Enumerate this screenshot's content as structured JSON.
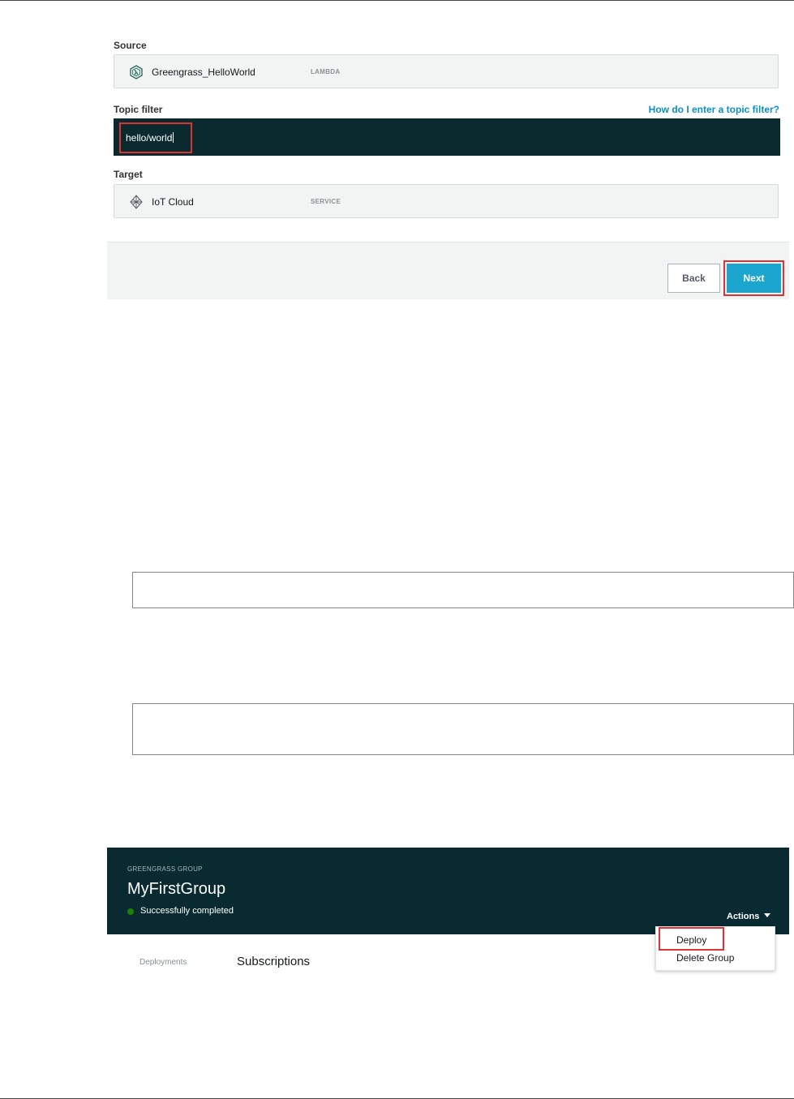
{
  "subscription_form": {
    "source": {
      "label": "Source",
      "name": "Greengrass_HelloWorld",
      "kind": "LAMBDA",
      "icon": "lambda-icon"
    },
    "topic_filter": {
      "label": "Topic filter",
      "value": "hello/world",
      "help_link": "How do I enter a topic filter?"
    },
    "target": {
      "label": "Target",
      "name": "IoT Cloud",
      "kind": "SERVICE",
      "icon": "iot-cloud-icon"
    },
    "back_label": "Back",
    "next_label": "Next"
  },
  "group": {
    "eyebrow": "GREENGRASS GROUP",
    "title": "MyFirstGroup",
    "status": "Successfully completed",
    "actions_label": "Actions",
    "tabs": [
      {
        "label": "Deployments"
      },
      {
        "label": "Subscriptions"
      }
    ],
    "menu": [
      {
        "label": "Deploy"
      },
      {
        "label": "Delete Group"
      }
    ]
  },
  "colors": {
    "accent": "#1ba5cf",
    "link": "#0a8fc9",
    "header_bg": "#092a31",
    "highlight": "#df3232",
    "status_ok": "#1d8102"
  }
}
